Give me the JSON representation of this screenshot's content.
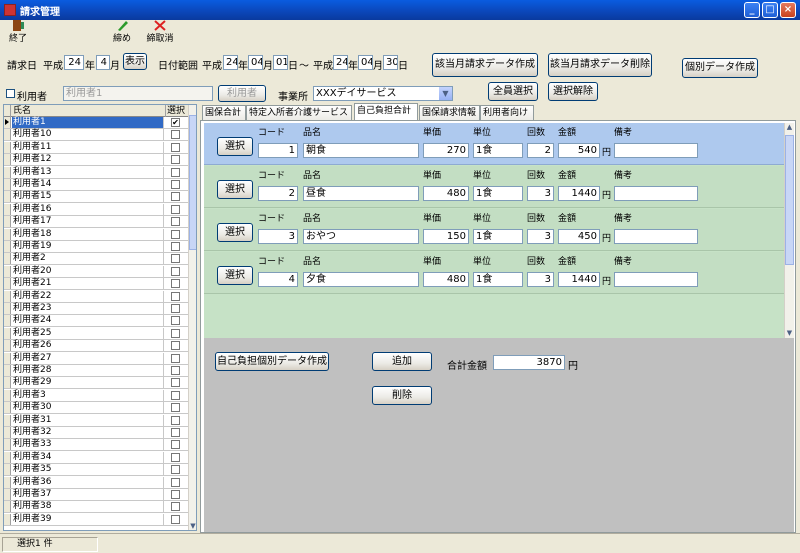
{
  "window": {
    "title": "請求管理"
  },
  "toolbar": {
    "exit_label": "終了",
    "close_label": "締め",
    "cancel_close_label": "締取消"
  },
  "filters": {
    "billing_date_label": "請求日",
    "era_label": "平成",
    "year": "24",
    "year_unit": "年",
    "month": "4",
    "month_unit": "月",
    "show_button": "表示",
    "date_range_label": "日付範囲",
    "from": {
      "era": "平成",
      "year": "24",
      "month": "04",
      "day": "01"
    },
    "to": {
      "era": "平成",
      "year": "24",
      "month": "04",
      "day": "30"
    },
    "day_unit": "日",
    "range_sep": "～",
    "user_checkbox_label": "利用者",
    "user_field_value": "利用者1",
    "user_button": "利用者",
    "office_label": "事業所",
    "office_value": "XXXデイサービス"
  },
  "actions": {
    "create_month": "該当月請求データ作成",
    "delete_month": "該当月請求データ削除",
    "individual": "個別データ作成",
    "select_all": "全員選択",
    "deselect": "選択解除"
  },
  "user_list": {
    "col_name": "氏名",
    "col_select": "選択",
    "rows": [
      {
        "name": "利用者1",
        "checked": true
      },
      {
        "name": "利用者10",
        "checked": false
      },
      {
        "name": "利用者11",
        "checked": false
      },
      {
        "name": "利用者12",
        "checked": false
      },
      {
        "name": "利用者13",
        "checked": false
      },
      {
        "name": "利用者14",
        "checked": false
      },
      {
        "name": "利用者15",
        "checked": false
      },
      {
        "name": "利用者16",
        "checked": false
      },
      {
        "name": "利用者17",
        "checked": false
      },
      {
        "name": "利用者18",
        "checked": false
      },
      {
        "name": "利用者19",
        "checked": false
      },
      {
        "name": "利用者2",
        "checked": false
      },
      {
        "name": "利用者20",
        "checked": false
      },
      {
        "name": "利用者21",
        "checked": false
      },
      {
        "name": "利用者22",
        "checked": false
      },
      {
        "name": "利用者23",
        "checked": false
      },
      {
        "name": "利用者24",
        "checked": false
      },
      {
        "name": "利用者25",
        "checked": false
      },
      {
        "name": "利用者26",
        "checked": false
      },
      {
        "name": "利用者27",
        "checked": false
      },
      {
        "name": "利用者28",
        "checked": false
      },
      {
        "name": "利用者29",
        "checked": false
      },
      {
        "name": "利用者3",
        "checked": false
      },
      {
        "name": "利用者30",
        "checked": false
      },
      {
        "name": "利用者31",
        "checked": false
      },
      {
        "name": "利用者32",
        "checked": false
      },
      {
        "name": "利用者33",
        "checked": false
      },
      {
        "name": "利用者34",
        "checked": false
      },
      {
        "name": "利用者35",
        "checked": false
      },
      {
        "name": "利用者36",
        "checked": false
      },
      {
        "name": "利用者37",
        "checked": false
      },
      {
        "name": "利用者38",
        "checked": false
      },
      {
        "name": "利用者39",
        "checked": false
      }
    ]
  },
  "tabs": [
    {
      "label": "国保合計"
    },
    {
      "label": "特定入所者介護サービス"
    },
    {
      "label": "自己負担合計"
    },
    {
      "label": "国保請求情報"
    },
    {
      "label": "利用者向け"
    }
  ],
  "items": {
    "labels": {
      "code": "コード",
      "name": "品名",
      "price": "単価",
      "unit": "単位",
      "count": "回数",
      "amount": "金額",
      "note": "備考",
      "yen": "円",
      "select": "選択"
    },
    "rows": [
      {
        "code": "1",
        "name": "朝食",
        "price": "270",
        "unit": "1食",
        "count": "2",
        "amount": "540",
        "note": ""
      },
      {
        "code": "2",
        "name": "昼食",
        "price": "480",
        "unit": "1食",
        "count": "3",
        "amount": "1440",
        "note": ""
      },
      {
        "code": "3",
        "name": "おやつ",
        "price": "150",
        "unit": "1食",
        "count": "3",
        "amount": "450",
        "note": ""
      },
      {
        "code": "4",
        "name": "夕食",
        "price": "480",
        "unit": "1食",
        "count": "3",
        "amount": "1440",
        "note": ""
      }
    ]
  },
  "lower": {
    "create_individual": "自己負担個別データ作成",
    "add": "追加",
    "delete": "削除",
    "total_label": "合計金額",
    "total_value": "3870",
    "yen": "円"
  },
  "status": {
    "text": "選択1 件"
  }
}
